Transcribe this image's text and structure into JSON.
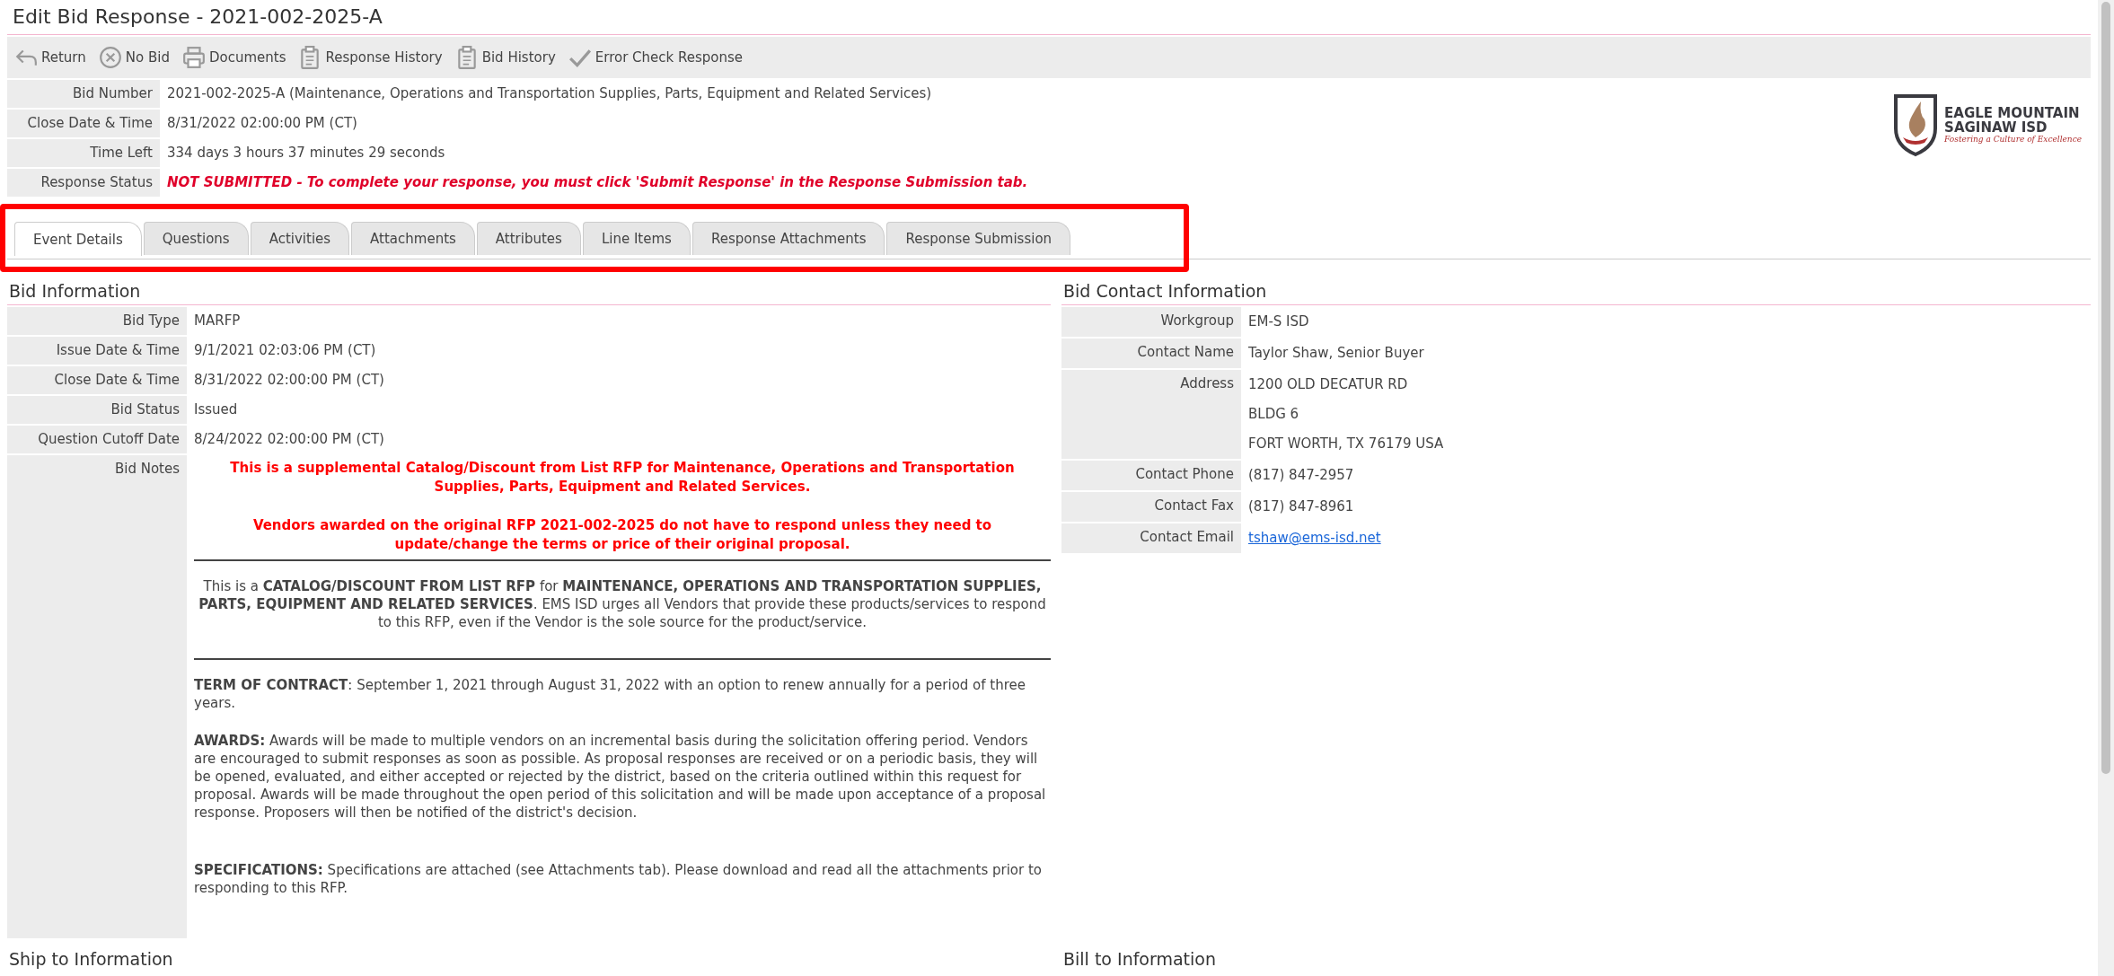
{
  "page_title": "Edit Bid Response - 2021-002-2025-A",
  "toolbar": [
    {
      "label": "Return",
      "kind": "return"
    },
    {
      "label": "No Bid",
      "kind": "nobid"
    },
    {
      "label": "Documents",
      "kind": "printer"
    },
    {
      "label": "Response History",
      "kind": "clipboard"
    },
    {
      "label": "Bid History",
      "kind": "clipboard"
    },
    {
      "label": "Error Check Response",
      "kind": "check"
    }
  ],
  "summary": [
    {
      "label": "Bid Number",
      "value": "2021-002-2025-A (Maintenance, Operations and Transportation Supplies, Parts, Equipment and Related Services)",
      "kind": "plain"
    },
    {
      "label": "Close Date & Time",
      "value": "8/31/2022 02:00:00 PM (CT)",
      "kind": "plain"
    },
    {
      "label": "Time Left",
      "value": "334 days 3 hours 37 minutes 29 seconds",
      "kind": "plain"
    },
    {
      "label": "Response Status",
      "value": "NOT SUBMITTED - To complete your response, you must click 'Submit Response' in the Response Submission tab.",
      "kind": "alert"
    }
  ],
  "logo": {
    "line_1": "EAGLE MOUNTAIN",
    "line_2": "SAGINAW ISD",
    "tagline": "Fostering a Culture of Excellence"
  },
  "tabs": [
    {
      "label": "Event Details",
      "selected": true
    },
    {
      "label": "Questions",
      "selected": false
    },
    {
      "label": "Activities",
      "selected": false
    },
    {
      "label": "Attachments",
      "selected": false
    },
    {
      "label": "Attributes",
      "selected": false
    },
    {
      "label": "Line Items",
      "selected": false
    },
    {
      "label": "Response Attachments",
      "selected": false
    },
    {
      "label": "Response Submission",
      "selected": false
    }
  ],
  "bid_information": {
    "title": "Bid Information",
    "rows": [
      {
        "label": "Bid Type",
        "value": "MARFP"
      },
      {
        "label": "Issue Date & Time",
        "value": "9/1/2021 02:03:06 PM (CT)"
      },
      {
        "label": "Close Date & Time",
        "value": "8/31/2022 02:00:00 PM (CT)"
      },
      {
        "label": "Bid Status",
        "value": "Issued"
      },
      {
        "label": "Question Cutoff Date",
        "value": "8/24/2022 02:00:00 PM (CT)"
      }
    ],
    "notes": {
      "label": "Bid Notes",
      "blocks": [
        {
          "kind": "alert",
          "text": "This is a supplemental Catalog/Discount from List RFP for Maintenance, Operations and Transportation Supplies, Parts, Equipment and Related Services."
        },
        {
          "kind": "alert",
          "text": "Vendors awarded on the original RFP 2021-002-2025 do not have to respond unless they need to update/change the terms or price of their original proposal."
        },
        {
          "kind": "rule"
        },
        {
          "kind": "intro",
          "text": "This is a **CATALOG/DISCOUNT FROM LIST RFP** for **MAINTENANCE, OPERATIONS AND TRANSPORTATION SUPPLIES, PARTS, EQUIPMENT AND RELATED SERVICES**. EMS ISD urges all Vendors that provide these products/services to respond to this RFP, even if the Vendor is the sole source for the product/service."
        },
        {
          "kind": "rule"
        },
        {
          "kind": "paragraph",
          "text": "**TERM OF CONTRACT**: September 1, 2021 through August 31, 2022 with an option to renew annually for a period of three years."
        },
        {
          "kind": "paragraph",
          "text": "**AWARDS:** Awards will be made to multiple vendors on an incremental basis during the solicitation offering period. Vendors are encouraged to submit responses as soon as possible. As proposal responses are received or on a periodic basis, they will be opened, evaluated, and either accepted or rejected by the district, based on the criteria outlined within this request for proposal. Awards will be made throughout the open period of this solicitation and will be made upon acceptance of a proposal response. Proposers will then be notified of the district's decision."
        },
        {
          "kind": "paragraph",
          "text": "**SPECIFICATIONS:** Specifications are attached (see Attachments tab). Please download and read all the attachments prior to responding to this RFP."
        }
      ]
    }
  },
  "bid_contact_information": {
    "title": "Bid Contact Information",
    "rows": [
      {
        "label": "Workgroup",
        "lines": [
          "EM-S ISD"
        ],
        "kind": "plain"
      },
      {
        "label": "Contact Name",
        "lines": [
          "Taylor Shaw, Senior Buyer"
        ],
        "kind": "plain"
      },
      {
        "label": "Address",
        "lines": [
          "1200 OLD DECATUR RD",
          "BLDG 6",
          "FORT WORTH, TX 76179 USA"
        ],
        "kind": "plain"
      },
      {
        "label": "Contact Phone",
        "lines": [
          "(817) 847-2957"
        ],
        "kind": "plain"
      },
      {
        "label": "Contact Fax",
        "lines": [
          "(817) 847-8961"
        ],
        "kind": "plain"
      },
      {
        "label": "Contact Email",
        "lines": [
          "tshaw@ems-isd.net"
        ],
        "kind": "link"
      }
    ]
  },
  "ship_to_information": {
    "title": "Ship to Information"
  },
  "bill_to_information": {
    "title": "Bill to Information"
  }
}
